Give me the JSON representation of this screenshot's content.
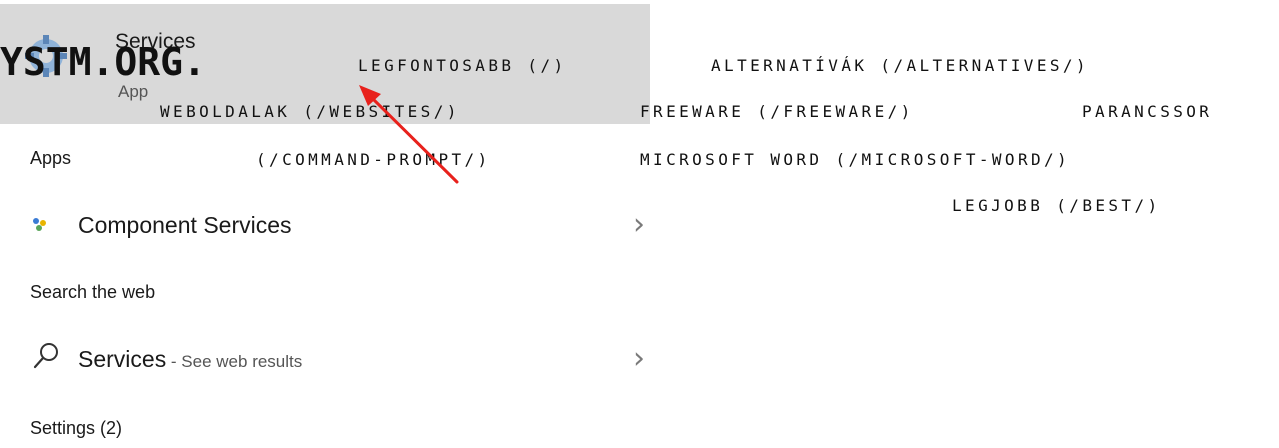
{
  "search_panel": {
    "best_match": {
      "title": "Services",
      "subtitle": "App",
      "icon": "gear-icon"
    },
    "apps_heading": "Apps",
    "apps": [
      {
        "icon": "component-services-icon",
        "label_prefix": "Component ",
        "label_highlight": "Services",
        "chevron": "›"
      }
    ],
    "web_heading": "Search the web",
    "web": [
      {
        "icon": "search-icon",
        "label": "Services",
        "suffix": " - See web results",
        "chevron": "›"
      }
    ],
    "settings_heading": "Settings (2)"
  },
  "site": {
    "logo": "YSTM.ORG.",
    "nav": [
      {
        "label": "LEGFONTOSABB (/)"
      },
      {
        "label": "ALTERNATÍVÁK (/ALTERNATIVES/)"
      },
      {
        "label": "WEBOLDALAK (/WEBSITES/)"
      },
      {
        "label": "FREEWARE (/FREEWARE/)"
      },
      {
        "label": "PARANCSSOR"
      },
      {
        "label": "(/COMMAND-PROMPT/)"
      },
      {
        "label": "MICROSOFT WORD (/MICROSOFT-WORD/)"
      },
      {
        "label": "LEGJOBB (/BEST/)"
      }
    ]
  },
  "colors": {
    "best_match_bg": "#d9d9d9",
    "arrow": "#e8211c",
    "text": "#111111"
  }
}
